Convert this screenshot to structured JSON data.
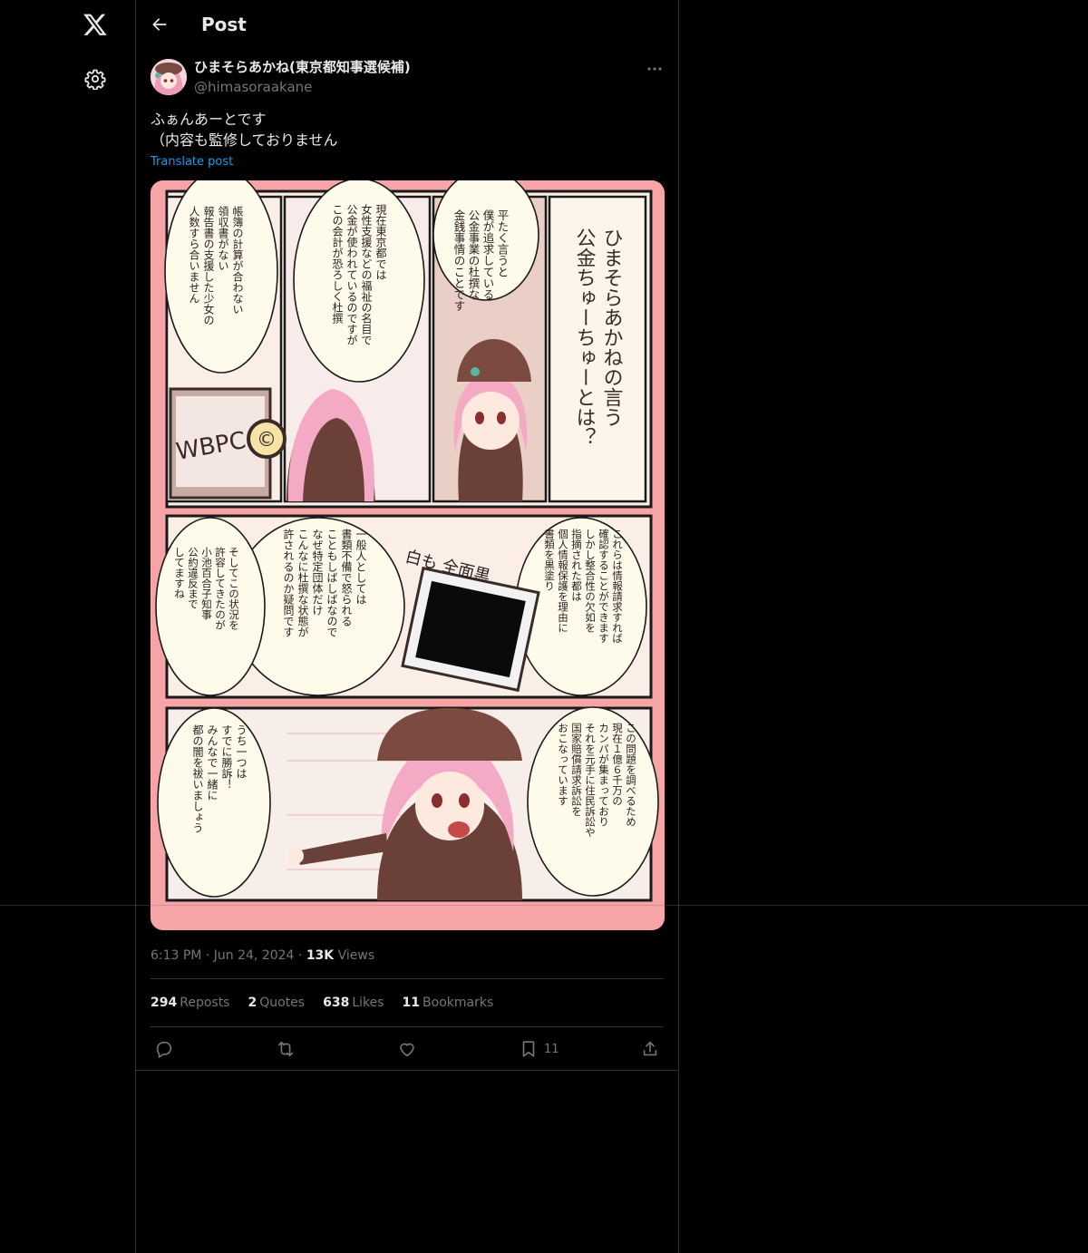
{
  "header": {
    "title": "Post"
  },
  "tweet": {
    "author_name": "ひまそらあかね(東京都知事選候補)",
    "author_handle": "@himasoraakane",
    "text_lines": [
      "ふぁんあーとです",
      "（内容も監修しておりません"
    ],
    "translate_label": "Translate post",
    "time": "6:13 PM",
    "date": "Jun 24, 2024",
    "views_count": "13K",
    "views_label": "Views",
    "sep": "·"
  },
  "stats": {
    "reposts": {
      "count": "294",
      "label": "Reposts"
    },
    "quotes": {
      "count": "2",
      "label": "Quotes"
    },
    "likes": {
      "count": "638",
      "label": "Likes"
    },
    "bookmarks": {
      "count": "11",
      "label": "Bookmarks"
    }
  },
  "actions": {
    "bookmark_count": "11"
  },
  "comic": {
    "title": "ひまそらあかねの言う公金ちゅーちゅーとは？",
    "panel1_bubble": "平たく言うと僕が追求している公金事業の杜撰な金銭事情のことです",
    "panel2_bubble": "現在東京都では女性支援などの福祉の名目で公金が使われているのですがこの会計が恐ろしく杜撰",
    "panel3_bubble": "帳簿の計算が合わない領収書がない報告書の支援した少女の人数すら合いません",
    "sign_text": "WBPC",
    "panel4_bubble": "これらは情報請求すれば確認することができますしかし整合性の欠如を指摘された都は個人情報保護を理由に書類を黒塗り",
    "panel5_bubble": "一般人としては書類不備で怒られることもしばしばなのでなぜ特定団体だけこんなに杜撰な状態が許されるのか疑問です",
    "panel5_sign": "白も 全面黒",
    "panel6_bubble": "そしてこの状況を許容してきたのが小池百合子知事公約違反までしてますね",
    "panel7_bubble": "この問題を調べるため現在１億６千万のカンパが集まっておりそれを元手に住民訴訟や国家賠償請求訴訟をおこなっています",
    "panel8_bubble": "うち一つはすでに勝訴！みんなで一緒に都の闇を祓いましょう"
  },
  "icons": [
    "x-logo-icon",
    "gear-icon",
    "back-arrow-icon",
    "more-icon",
    "reply-icon",
    "repost-icon",
    "like-icon",
    "bookmark-icon",
    "share-icon"
  ]
}
